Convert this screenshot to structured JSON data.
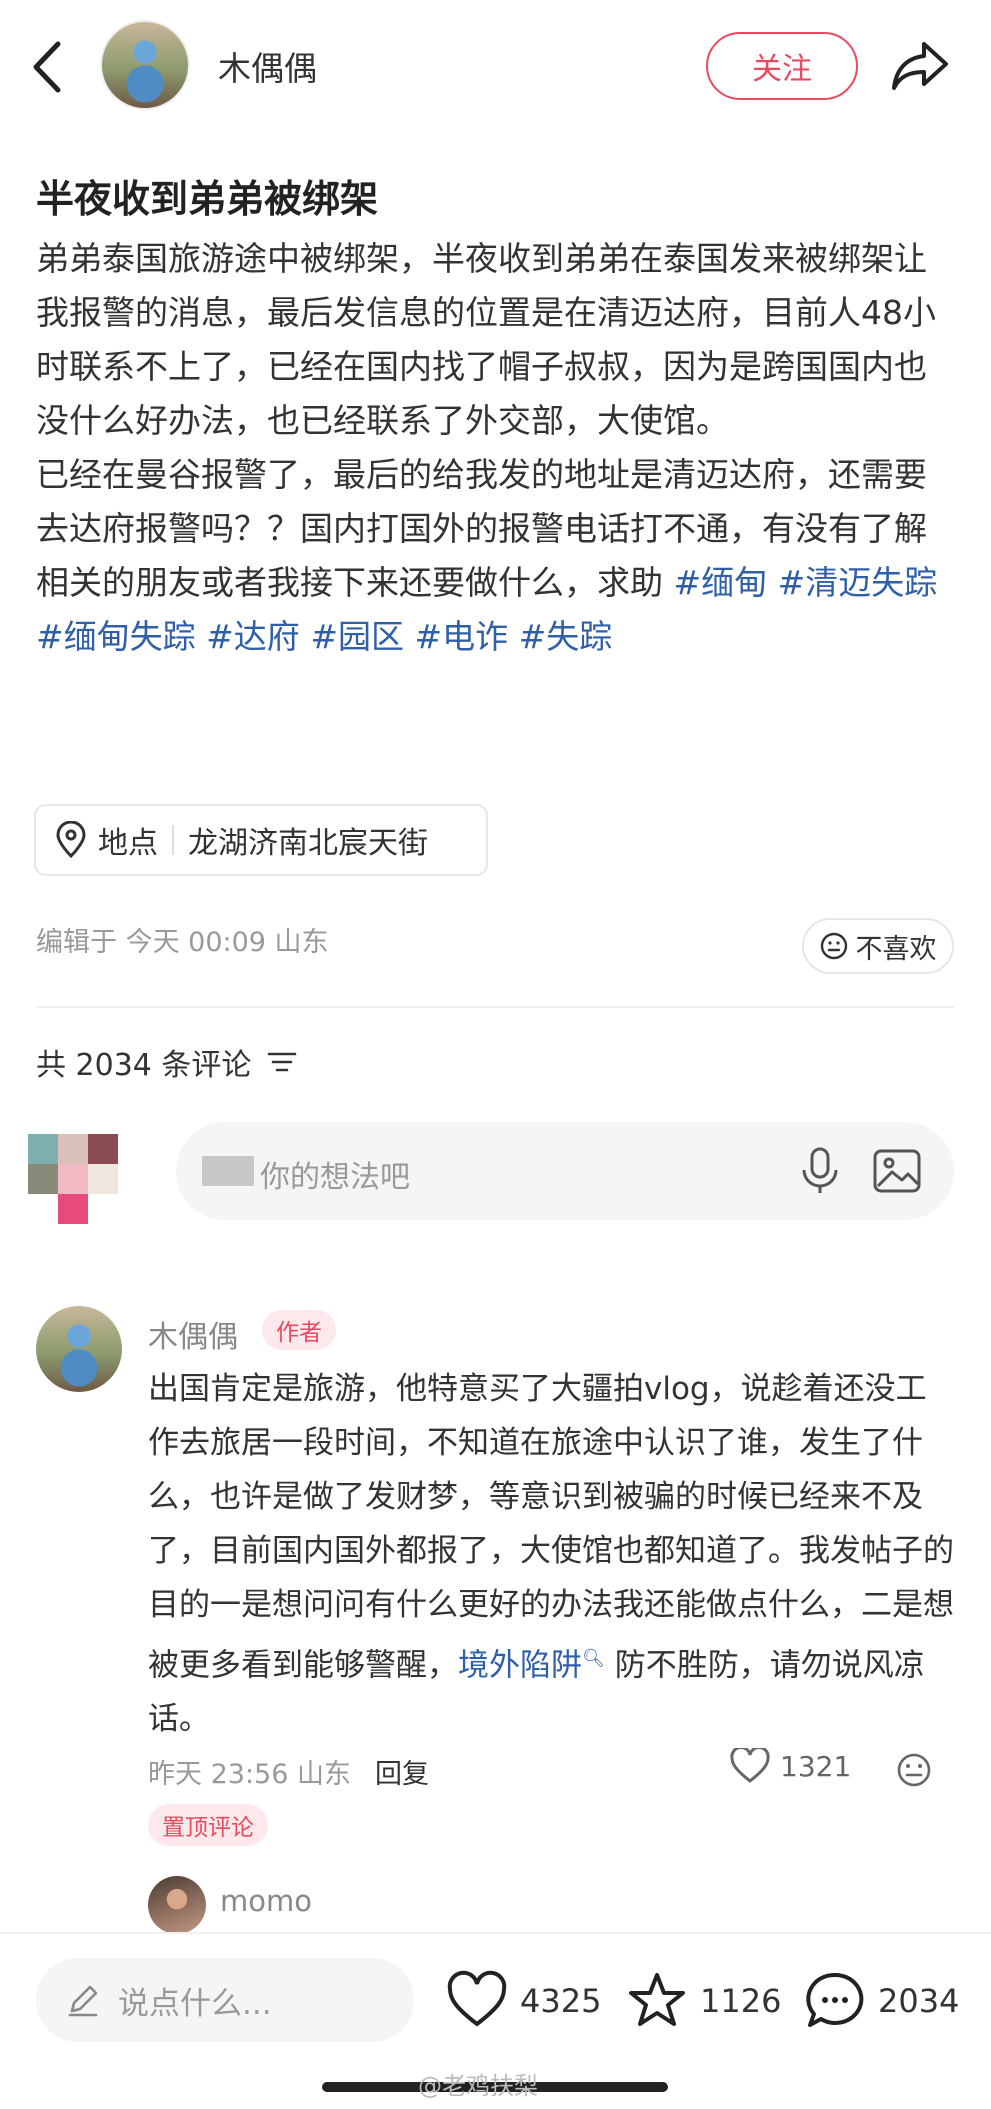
{
  "header": {
    "author_name": "木偶偶",
    "follow_label": "关注"
  },
  "post": {
    "title": "半夜收到弟弟被绑架",
    "paragraph1": "弟弟泰国旅游途中被绑架，半夜收到弟弟在泰国发来被绑架让我报警的消息，最后发信息的位置是在清迈达府，目前人48小时联系不上了，已经在国内找了帽子叔叔，因为是跨国国内也没什么好办法，也已经联系了外交部，大使馆。",
    "paragraph2_text": "已经在曼谷报警了，最后的给我发的地址是清迈达府，还需要去达府报警吗？？国内打国外的报警电话打不通，有没有了解相关的朋友或者我接下来还要做什么，求助",
    "tags": [
      "#缅甸",
      "#清迈失踪",
      "#缅甸失踪",
      "#达府",
      "#园区",
      "#电诈",
      "#失踪"
    ],
    "location_label": "地点",
    "location_value": "龙湖济南北宸天街",
    "edit_info": "编辑于 今天 00:09 山东",
    "dislike_label": "不喜欢"
  },
  "comments_section": {
    "count_label": "共 2034 条评论",
    "input_placeholder": "你的想法吧"
  },
  "comment": {
    "name": "木偶偶",
    "badge": "作者",
    "text_before_link": "出国肯定是旅游，他特意买了大疆拍vlog，说趁着还没工作去旅居一段时间，不知道在旅途中认识了谁，发生了什么，也许是做了发财梦，等意识到被骗的时候已经来不及了，目前国内国外都报了，大使馆也都知道了。我发帖子的目的一是想问问有什么更好的办法我还能做点什么，二是想被更多看到能够警醒，",
    "link_text": "境外陷阱",
    "text_after_link": "防不胜防，请勿说风凉话。",
    "time_location": "昨天 23:56 山东",
    "reply_label": "回复",
    "likes": "1321",
    "pinned_label": "置顶评论",
    "reply_preview_name": "momo"
  },
  "bottom_bar": {
    "input_placeholder": "说点什么...",
    "likes": "4325",
    "stars": "1126",
    "comments": "2034"
  },
  "watermark": "@老鸡扶梨",
  "colors": {
    "accent": "#e84a5f",
    "link": "#2f5fa7",
    "muted": "#999999"
  }
}
